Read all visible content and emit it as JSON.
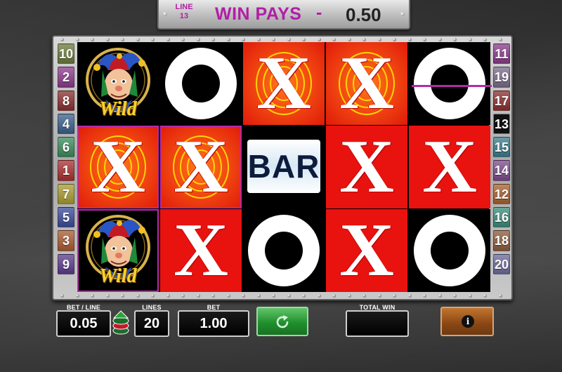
{
  "header": {
    "line_label": "LINE\n13",
    "line_label_1": "LINE",
    "line_label_2": "13",
    "win_pays_label": "WIN PAYS",
    "dash": "-",
    "win_value": "0.50"
  },
  "paylines": {
    "left": [
      "10",
      "2",
      "8",
      "4",
      "6",
      "1",
      "7",
      "5",
      "3",
      "9"
    ],
    "right": [
      "11",
      "19",
      "17",
      "13",
      "15",
      "14",
      "12",
      "16",
      "18",
      "20"
    ],
    "active": "13",
    "colors_left": [
      "#6b7a3a",
      "#8a3a8a",
      "#8a2e2e",
      "#3a5f8a",
      "#3a8a5c",
      "#a83030",
      "#a89a30",
      "#3a4a9a",
      "#a85a30",
      "#5a3a8a"
    ],
    "colors_right": [
      "#8a3a8a",
      "#7a6a8a",
      "#8a2e2e",
      "#000000",
      "#3a7a8a",
      "#7a4a8a",
      "#a8602e",
      "#3a8a7a",
      "#8a5a3a",
      "#6a6a9a"
    ]
  },
  "reels": [
    [
      "wild",
      "x-orange",
      "wild"
    ],
    [
      "o",
      "x-orange",
      "x-red"
    ],
    [
      "x-orange",
      "bar",
      "o"
    ],
    [
      "x-orange",
      "x-red",
      "x-red"
    ],
    [
      "o",
      "x-red",
      "o"
    ]
  ],
  "symbols": {
    "x_glyph": "X",
    "bar_text": "BAR",
    "wild_text": "Wild"
  },
  "controls": {
    "bet_line_label": "BET / LINE",
    "bet_line_value": "0.05",
    "lines_label": "LINES",
    "lines_value": "20",
    "bet_label": "BET",
    "bet_value": "1.00",
    "total_win_label": "TOTAL WIN",
    "total_win_value": "",
    "spin_icon": "refresh-icon",
    "info_icon": "info-icon",
    "info_glyph": "i"
  },
  "colors": {
    "accent_purple": "#b01fa6",
    "reel_red": "#e8120f",
    "spin_green": "#20902e",
    "info_orange": "#8a4614"
  }
}
